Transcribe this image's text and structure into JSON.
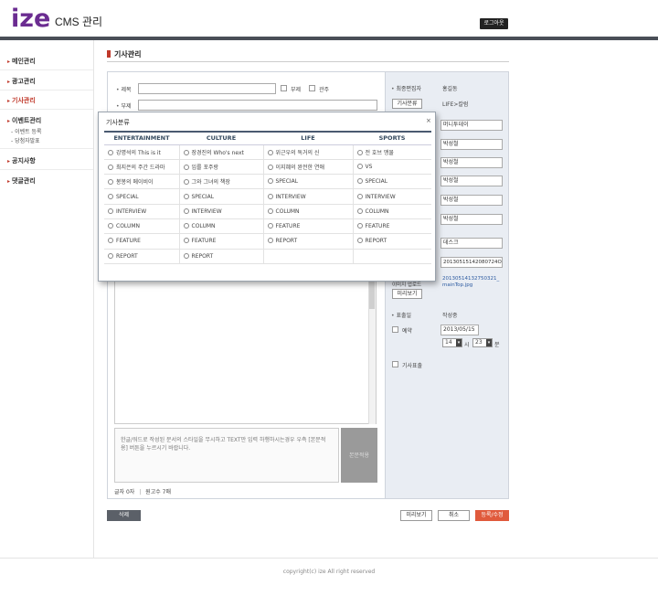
{
  "header": {
    "logo_text": "ize",
    "app_title": "CMS 관리",
    "logout_label": "로그아웃"
  },
  "sidebar": {
    "items": [
      {
        "label": "메인관리"
      },
      {
        "label": "광고관리"
      },
      {
        "label": "기사관리"
      },
      {
        "label": "이벤트관리"
      },
      {
        "label": "공지사항"
      },
      {
        "label": "댓글관리"
      }
    ],
    "event_subitems": [
      "- 이벤트 등록",
      "- 당첨자발표"
    ]
  },
  "page": {
    "title": "기사관리"
  },
  "form": {
    "title_label": "제목",
    "subtitle_label": "부제",
    "sub_check_label": "부제",
    "comment_check_label": "관주",
    "editor_label": "최종편집자",
    "editor_value": "홍길동",
    "category_button": "기사분류",
    "category_value": "LIFE>칼럼",
    "writer_fields": [
      "머니투데이",
      "박성철",
      "박성철",
      "박성철",
      "박성철",
      "박성철"
    ],
    "desk_value": "데스크",
    "article_id": "20130515142080724O",
    "image_label": "이미지 업로드",
    "image_link": "20130514132750321_ mainTop.jpg",
    "preview_button": "미리보기",
    "display_label": "표출일",
    "display_value": "작성중",
    "reserve_label": "예약",
    "date_value": "2013/05/15",
    "hour_value": "14",
    "hour_unit": "시",
    "minute_value": "23",
    "minute_unit": "분",
    "article_display_label": "기사표출",
    "note_text": "한글/워드로 작성된 문서의 스타일을 무시하고 TEXT만 입력 하행하시는경우 우측 [본문적용] 버튼을 누르시기 바랍니다.",
    "apply_button": "본문적용",
    "counts_label": "글자 0자",
    "counts_sep": "|",
    "manuscript_label": "원고수 7매"
  },
  "actions": {
    "delete": "삭제",
    "preview": "미리보기",
    "cancel": "취소",
    "submit": "등록/수정"
  },
  "footer": {
    "copyright": "copyright(c) ize All right reserved"
  },
  "modal": {
    "title": "기사분류",
    "close": "×",
    "columns": [
      "ENTERTAINMENT",
      "CULTURE",
      "LIFE",
      "SPORTS"
    ],
    "rows": [
      [
        "강명석의  This is it",
        "장경진의 Who's next",
        "위근우의 독거의 신",
        "전 호브 맹물"
      ],
      [
        "최지은의 주간 드라마",
        "임를 포주랑",
        "이지혜의 완전한 연애",
        "VS"
      ],
      [
        "봉봉의 메이비이",
        "그와 그녀의 책장",
        "SPECIAL",
        "SPECIAL"
      ],
      [
        "SPECIAL",
        "SPECIAL",
        "INTERVIEW",
        "INTERVIEW"
      ],
      [
        "INTERVIEW",
        "INTERVIEW",
        "COLUMN",
        "COLUMN"
      ],
      [
        "COLUMN",
        "COLUMN",
        "FEATURE",
        "FEATURE"
      ],
      [
        "FEATURE",
        "FEATURE",
        "REPORT",
        "REPORT"
      ],
      [
        "REPORT",
        "REPORT",
        "",
        ""
      ]
    ]
  },
  "colors": {
    "accent_red": "#c0392b",
    "header_bar": "#4a4f57",
    "submit_button": "#e05a3c",
    "logo_purple": "#6b2c91"
  }
}
